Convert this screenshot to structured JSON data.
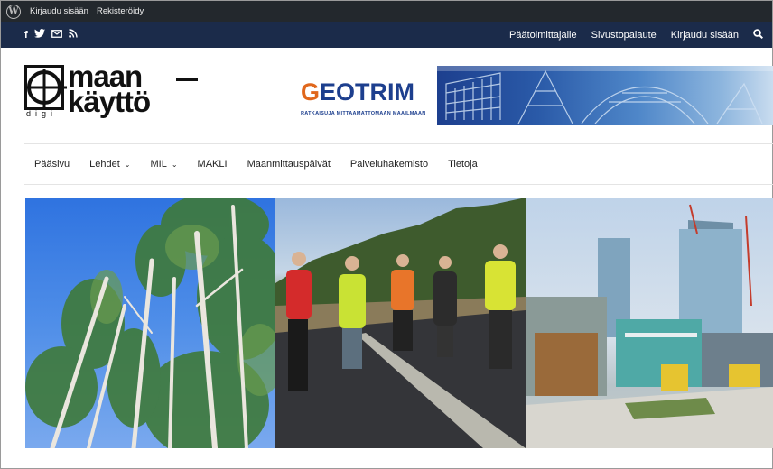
{
  "admin_bar": {
    "login": "Kirjaudu sisään",
    "register": "Rekisteröidy"
  },
  "topbar": {
    "social": [
      "f",
      "twitter",
      "mail",
      "rss"
    ],
    "links": [
      "Päätoimittajalle",
      "Sivustopalaute",
      "Kirjaudu sisään"
    ]
  },
  "logo": {
    "line1": "maan",
    "line2": "käyttö",
    "sub": "digi"
  },
  "banner": {
    "brand_first": "G",
    "brand_rest": "EOTRIM",
    "tagline": "RATKAISUJA MITTAAMATTOMAAN MAAILMAAN"
  },
  "nav": {
    "items": [
      {
        "label": "Pääsivu",
        "has_dropdown": false
      },
      {
        "label": "Lehdet",
        "has_dropdown": true
      },
      {
        "label": "MIL",
        "has_dropdown": true
      },
      {
        "label": "MAKLI",
        "has_dropdown": false
      },
      {
        "label": "Maanmittauspäivät",
        "has_dropdown": false
      },
      {
        "label": "Palveluhakemisto",
        "has_dropdown": false
      },
      {
        "label": "Tietoja",
        "has_dropdown": false
      }
    ]
  },
  "colors": {
    "admin_bar": "#23282d",
    "top_bar": "#1b2b4a",
    "brand_blue": "#1d3f8e",
    "brand_orange": "#e0671c"
  }
}
